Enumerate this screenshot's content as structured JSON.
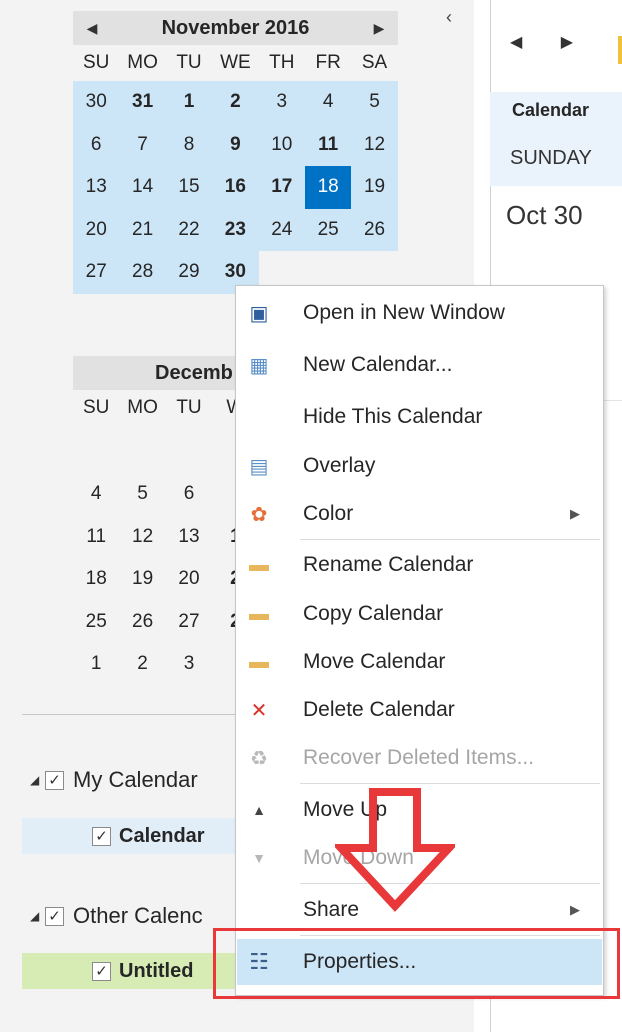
{
  "navigation_pane": {
    "collapse_glyph": "‹",
    "calendars": [
      {
        "month_title": "November 2016",
        "prev_glyph": "◀",
        "next_glyph": "▶",
        "weekdays": [
          "SU",
          "MO",
          "TU",
          "WE",
          "TH",
          "FR",
          "SA"
        ],
        "weeks": [
          [
            "30",
            "31",
            "1",
            "2",
            "3",
            "4",
            "5"
          ],
          [
            "6",
            "7",
            "8",
            "9",
            "10",
            "11",
            "12"
          ],
          [
            "13",
            "14",
            "15",
            "16",
            "17",
            "18",
            "19"
          ],
          [
            "20",
            "21",
            "22",
            "23",
            "24",
            "25",
            "26"
          ],
          [
            "27",
            "28",
            "29",
            "30",
            "",
            "",
            ""
          ]
        ]
      },
      {
        "month_title": "Decemb",
        "weekdays": [
          "SU",
          "MO",
          "TU",
          "W"
        ],
        "weeks": [
          [
            "4",
            "5",
            "6"
          ],
          [
            "11",
            "12",
            "13",
            "1"
          ],
          [
            "18",
            "19",
            "20",
            "2"
          ],
          [
            "25",
            "26",
            "27",
            "2"
          ],
          [
            "1",
            "2",
            "3"
          ]
        ]
      }
    ],
    "groups": [
      {
        "label": "My Calendar",
        "check": "✓",
        "expander": "◢",
        "item": "Calendar"
      },
      {
        "label": "Other Calenc",
        "check": "✓",
        "expander": "◢",
        "item": "Untitled"
      }
    ]
  },
  "main_view": {
    "prev_glyph": "◀",
    "next_glyph": "▶",
    "column_title": "Calendar",
    "day_label": "SUNDAY",
    "date_label": "Oct 30"
  },
  "context_menu": {
    "items": [
      {
        "label": "Open in New Window",
        "icon": "new-window-icon",
        "glyph": "▣"
      },
      {
        "label": "New Calendar...",
        "icon": "new-calendar-icon",
        "glyph": "▦"
      },
      {
        "label": "Hide This Calendar",
        "icon": "",
        "glyph": ""
      },
      {
        "label": "Overlay",
        "icon": "overlay-icon",
        "glyph": "▤"
      },
      {
        "label": "Color",
        "icon": "color-wheel-icon",
        "glyph": "✿",
        "submenu": "▶"
      },
      {
        "label": "Rename Calendar",
        "icon": "rename-folder-icon",
        "glyph": "▬"
      },
      {
        "label": "Copy Calendar",
        "icon": "copy-folder-icon",
        "glyph": "▬"
      },
      {
        "label": "Move Calendar",
        "icon": "move-folder-icon",
        "glyph": "▬"
      },
      {
        "label": "Delete Calendar",
        "icon": "delete-folder-icon",
        "glyph": "✕"
      },
      {
        "label": "Recover Deleted Items...",
        "icon": "recover-icon",
        "glyph": "♻"
      },
      {
        "label": "Move Up",
        "icon": "move-up-icon",
        "glyph": "▲"
      },
      {
        "label": "Move Down",
        "icon": "move-down-icon",
        "glyph": "▼"
      },
      {
        "label": "Share",
        "icon": "",
        "glyph": "",
        "submenu": "▶"
      },
      {
        "label": "Properties...",
        "icon": "properties-icon",
        "glyph": "☷"
      }
    ]
  },
  "colors": {
    "selection_blue": "#cde6f7",
    "today_blue": "#0072c6",
    "annotation_red": "#e8383a",
    "folder_tan": "#e8b65c"
  }
}
